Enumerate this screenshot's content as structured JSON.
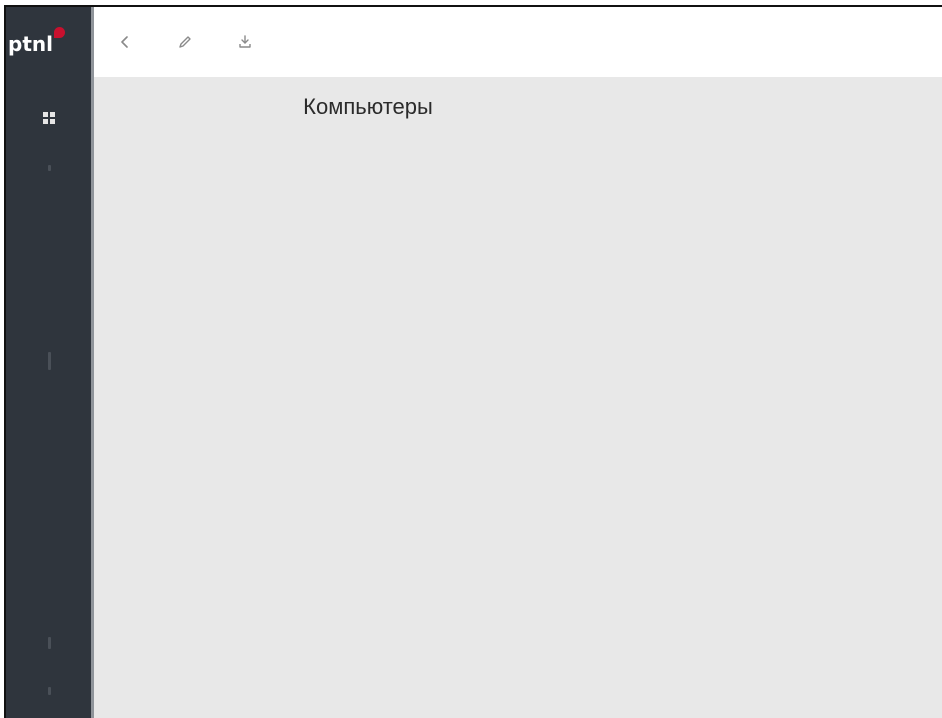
{
  "app": {
    "logo_text": "ptnl",
    "brand_color": "#c8102e",
    "sidebar_color": "#2f353d"
  },
  "sidebar": {
    "items": [
      {
        "icon": "dashboard-icon"
      }
    ]
  },
  "toolbar": {
    "buttons": [
      {
        "icon": "back-arrow-icon"
      },
      {
        "icon": "pencil-icon"
      },
      {
        "icon": "download-icon"
      }
    ]
  },
  "main": {
    "title": "Компьютеры"
  }
}
